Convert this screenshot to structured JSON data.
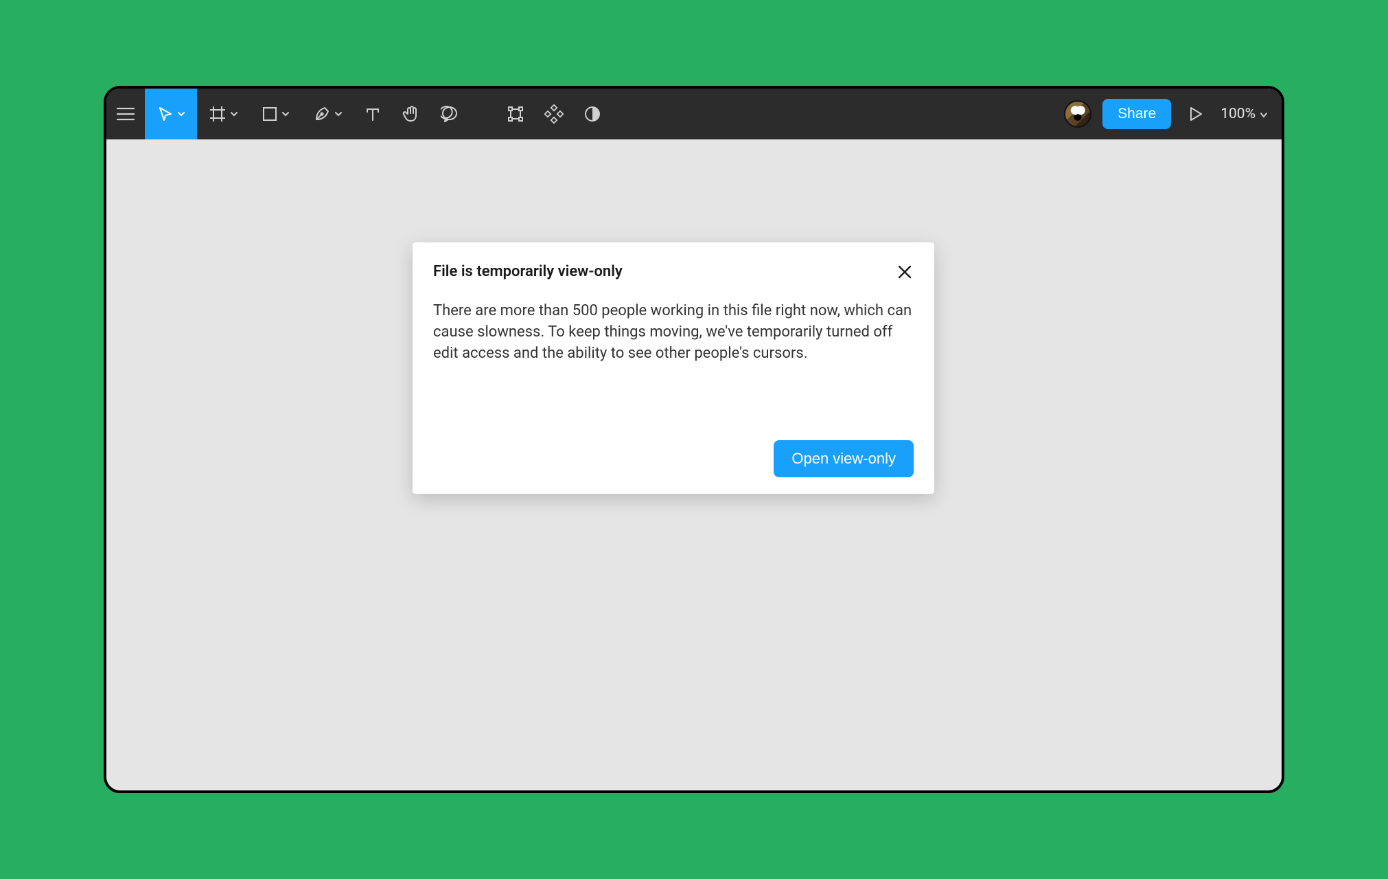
{
  "toolbar": {
    "share_label": "Share",
    "zoom_label": "100%"
  },
  "modal": {
    "title": "File is temporarily view-only",
    "body": "There are more than 500 people working in this file right now, which can cause slowness. To keep things moving, we've temporarily turned off edit access and the ability to see other people's cursors.",
    "primary_label": "Open view-only"
  }
}
